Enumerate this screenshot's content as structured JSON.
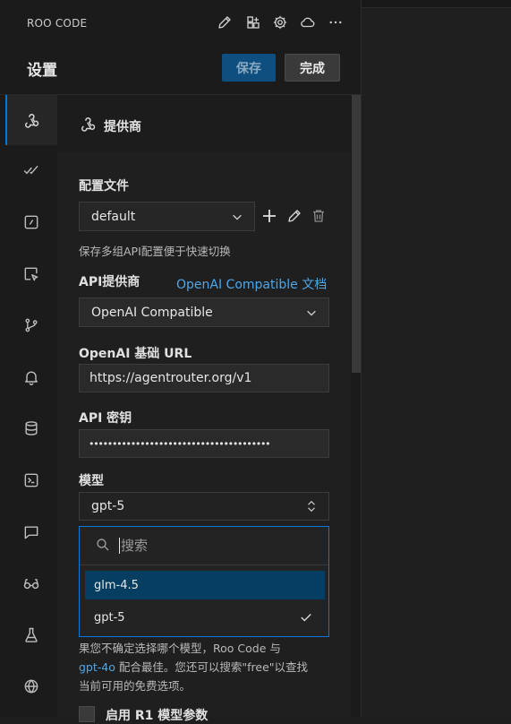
{
  "app": {
    "title": "ROO CODE"
  },
  "header_icons": [
    {
      "name": "edit-icon"
    },
    {
      "name": "extensions-icon"
    },
    {
      "name": "gear-icon"
    },
    {
      "name": "cloud-icon"
    },
    {
      "name": "more-icon"
    }
  ],
  "settings": {
    "title": "设置",
    "save_label": "保存",
    "done_label": "完成"
  },
  "sidebar": {
    "items": [
      {
        "name": "providers",
        "icon": "webhook-icon",
        "active": true
      },
      {
        "name": "auto-approve",
        "icon": "check-check-icon"
      },
      {
        "name": "browser",
        "icon": "square-slash-icon"
      },
      {
        "name": "context",
        "icon": "pointer-icon"
      },
      {
        "name": "checkpoints",
        "icon": "git-branch-icon"
      },
      {
        "name": "notifications",
        "icon": "bell-icon"
      },
      {
        "name": "database",
        "icon": "database-icon"
      },
      {
        "name": "terminal",
        "icon": "terminal-icon"
      },
      {
        "name": "prompts",
        "icon": "message-icon"
      },
      {
        "name": "experimental",
        "icon": "glasses-icon"
      },
      {
        "name": "lab",
        "icon": "flask-icon"
      },
      {
        "name": "language",
        "icon": "globe-icon"
      }
    ]
  },
  "section": {
    "title": "提供商",
    "icon": "webhook-icon"
  },
  "profile": {
    "label": "配置文件",
    "value": "default",
    "hint": "保存多组API配置便于快速切换"
  },
  "api_provider": {
    "label": "API提供商",
    "doc_link": "OpenAI Compatible 文档",
    "value": "OpenAI Compatible"
  },
  "base_url": {
    "label": "OpenAI 基础 URL",
    "value": "https://agentrouter.org/v1"
  },
  "api_key": {
    "label": "API 密钥",
    "value": "•••••••••••••••••••••••••••••••••••••••"
  },
  "model": {
    "label": "模型",
    "value": "gpt-5",
    "search_placeholder": "搜索",
    "options": [
      {
        "label": "glm-4.5",
        "highlighted": true
      },
      {
        "label": "gpt-5",
        "selected": true
      }
    ]
  },
  "model_hint": {
    "line1": "果您不确定选择哪个模型，Roo Code 与",
    "link": "gpt-4o",
    "line2_rest": " 配合最佳。您还可以搜索\"free\"以查找",
    "line3": "当前可用的免费选项。"
  },
  "r1_param": {
    "label": "启用 R1 模型参数"
  },
  "colors": {
    "accent": "#0078d4",
    "link": "#4ea6e8",
    "save_bg": "#0e4f7f",
    "highlight": "#063e62"
  }
}
